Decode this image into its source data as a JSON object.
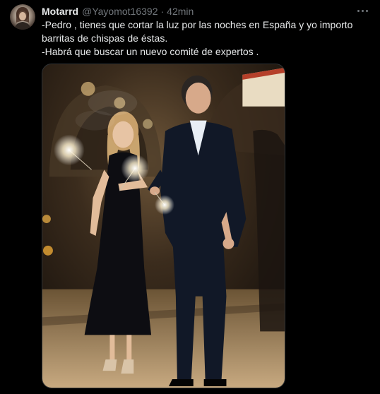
{
  "tweet": {
    "author_name": "Motarrd",
    "author_handle": "@Yayomot16392",
    "separator": "·",
    "timestamp": "42min",
    "text_lines": [
      "-Pedro , tienes que cortar la luz por las noches en España y yo importo barritas de chispas de éstas.",
      "-Habrá que buscar un nuevo comité de expertos ."
    ]
  },
  "icons": {
    "more": "more-horizontal-icon",
    "avatar": "user-avatar"
  }
}
